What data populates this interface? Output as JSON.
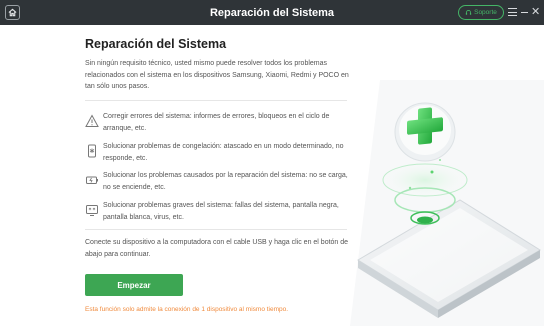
{
  "titlebar": {
    "title": "Reparación del Sistema",
    "support_label": "Soporte",
    "icons": [
      "home-icon",
      "headset-icon",
      "menu-icon",
      "minimize-icon",
      "close-icon"
    ]
  },
  "main": {
    "heading": "Reparación del Sistema",
    "intro": "Sin ningún requisito técnico, usted mismo puede resolver todos los problemas relacionados con el sistema en los dispositivos Samsung, Xiaomi, Redmi y POCO en tan sólo unos pasos.",
    "features": [
      {
        "icon": "warning-icon",
        "text": "Corregir errores del sistema: informes de errores, bloqueos en el ciclo de arranque, etc."
      },
      {
        "icon": "frozen-phone-icon",
        "text": "Solucionar problemas de congelación: atascado en un modo determinado, no responde, etc."
      },
      {
        "icon": "battery-icon",
        "text": "Solucionar los problemas causados por la reparación del sistema: no se carga, no se enciende, etc."
      },
      {
        "icon": "broken-screen-icon",
        "text": "Solucionar problemas graves del sistema: fallas del sistema, pantalla negra, pantalla blanca, virus, etc."
      }
    ],
    "connect_text": "Conecte su dispositivo a la computadora con el cable USB y haga clic en el botón de abajo para continuar.",
    "start_button": "Empezar",
    "note": "Esta función solo admite la conexión de 1 dispositivo al mismo tiempo."
  },
  "colors": {
    "titlebar": "#2f3438",
    "accent_green": "#3da653",
    "note_orange": "#f08a3c"
  }
}
